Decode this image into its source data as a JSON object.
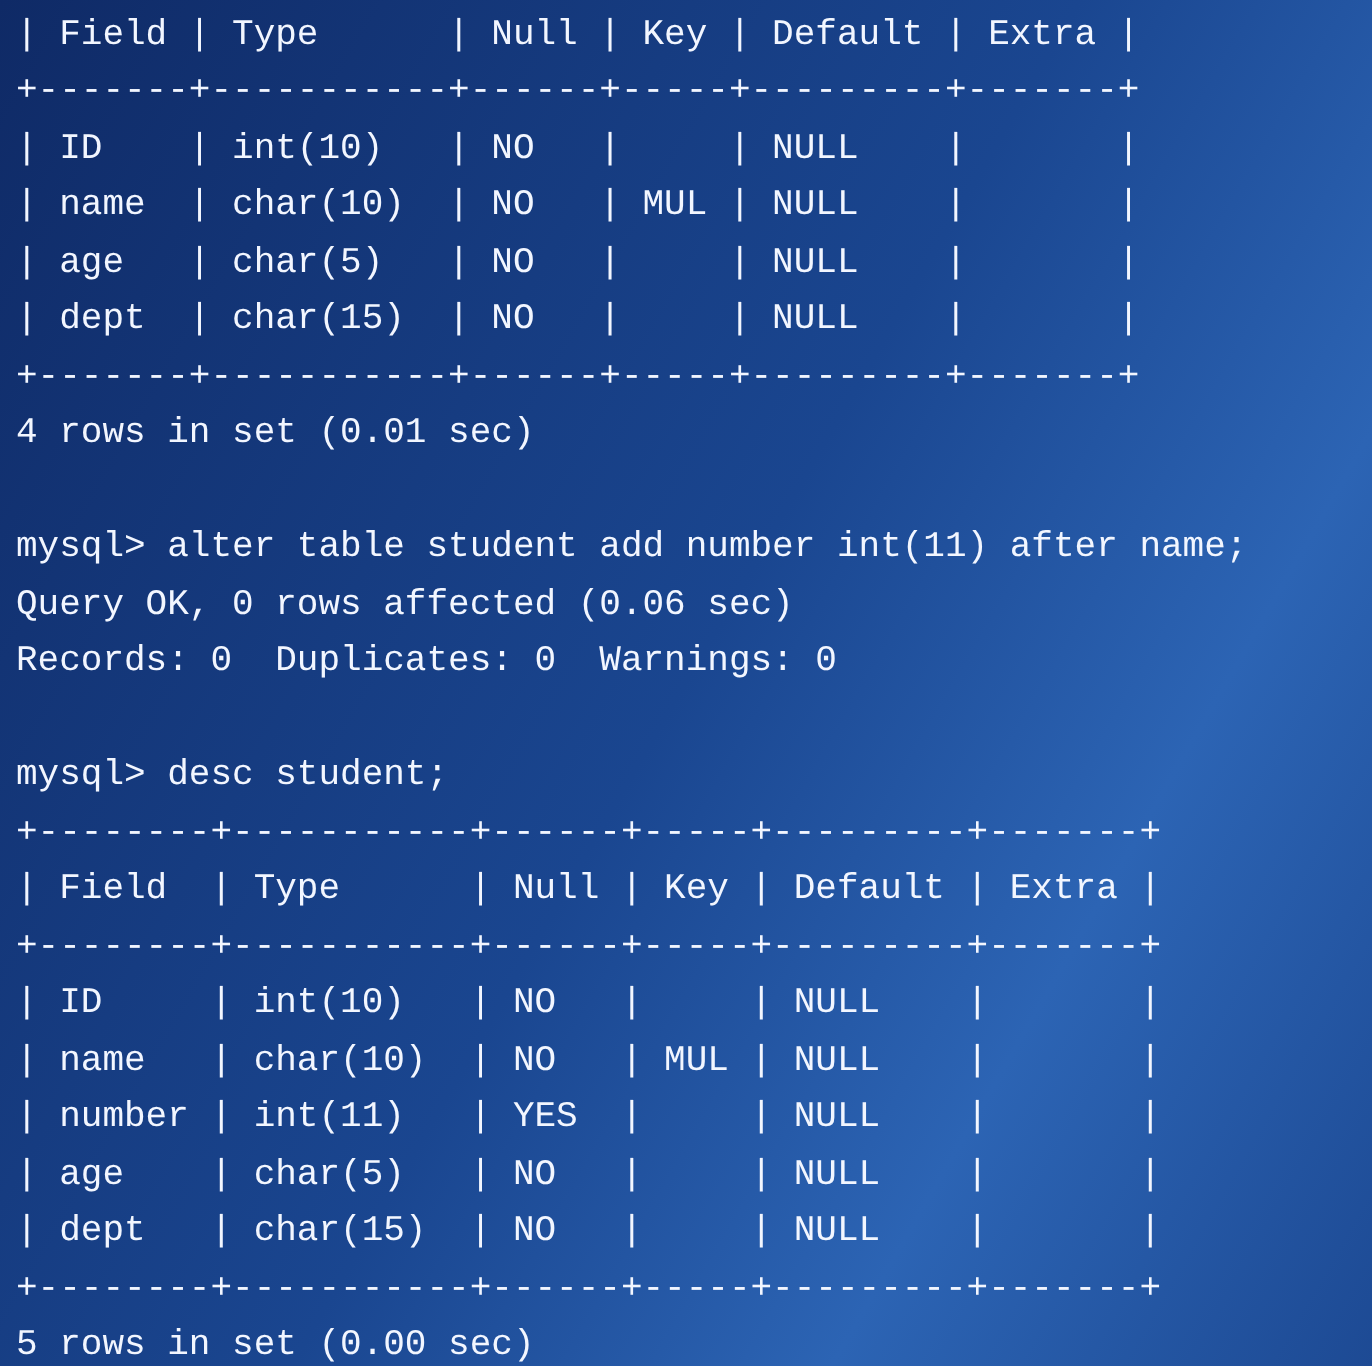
{
  "terminal": {
    "lines": [
      {
        "kind": "output",
        "text": "| Field | Type      | Null | Key | Default | Extra |"
      },
      {
        "kind": "output",
        "text": "+-------+-----------+------+-----+---------+-------+"
      },
      {
        "kind": "output",
        "text": "| ID    | int(10)   | NO   |     | NULL    |       |"
      },
      {
        "kind": "output",
        "text": "| name  | char(10)  | NO   | MUL | NULL    |       |"
      },
      {
        "kind": "output",
        "text": "| age   | char(5)   | NO   |     | NULL    |       |"
      },
      {
        "kind": "output",
        "text": "| dept  | char(15)  | NO   |     | NULL    |       |"
      },
      {
        "kind": "output",
        "text": "+-------+-----------+------+-----+---------+-------+"
      },
      {
        "kind": "output",
        "text": "4 rows in set (0.01 sec)"
      },
      {
        "kind": "blank"
      },
      {
        "kind": "command",
        "prompt": "mysql>",
        "text": "alter table student add number int(11) after name;"
      },
      {
        "kind": "output",
        "text": "Query OK, 0 rows affected (0.06 sec)"
      },
      {
        "kind": "output",
        "text": "Records: 0  Duplicates: 0  Warnings: 0"
      },
      {
        "kind": "blank"
      },
      {
        "kind": "command",
        "prompt": "mysql>",
        "text": "desc student;"
      },
      {
        "kind": "output",
        "text": "+--------+-----------+------+-----+---------+-------+"
      },
      {
        "kind": "output",
        "text": "| Field  | Type      | Null | Key | Default | Extra |"
      },
      {
        "kind": "output",
        "text": "+--------+-----------+------+-----+---------+-------+"
      },
      {
        "kind": "output",
        "text": "| ID     | int(10)   | NO   |     | NULL    |       |"
      },
      {
        "kind": "output",
        "text": "| name   | char(10)  | NO   | MUL | NULL    |       |"
      },
      {
        "kind": "output",
        "text": "| number | int(11)   | YES  |     | NULL    |       |"
      },
      {
        "kind": "output",
        "text": "| age    | char(5)   | NO   |     | NULL    |       |"
      },
      {
        "kind": "output",
        "text": "| dept   | char(15)  | NO   |     | NULL    |       |"
      },
      {
        "kind": "output",
        "text": "+--------+-----------+------+-----+---------+-------+"
      },
      {
        "kind": "output",
        "text": "5 rows in set (0.00 sec)"
      }
    ]
  }
}
